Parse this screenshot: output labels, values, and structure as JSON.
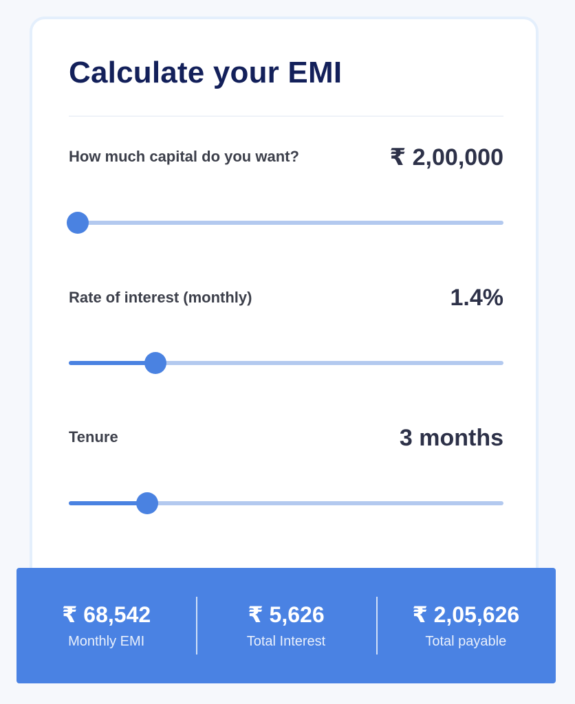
{
  "title": "Calculate your EMI",
  "capital": {
    "label": "How much capital do you want?",
    "value": "₹ 2,00,000",
    "slider_fraction": 0.02
  },
  "interest": {
    "label": "Rate of interest (monthly)",
    "value": "1.4%",
    "slider_fraction": 0.2
  },
  "tenure": {
    "label": "Tenure",
    "value": "3 months",
    "slider_fraction": 0.18
  },
  "summary": {
    "monthly_emi": {
      "value": "₹ 68,542",
      "label": "Monthly EMI"
    },
    "total_interest": {
      "value": "₹ 5,626",
      "label": "Total Interest"
    },
    "total_payable": {
      "value": "₹ 2,05,626",
      "label": "Total payable"
    }
  },
  "colors": {
    "accent": "#4a82e1",
    "track": "#b3c9ef",
    "title": "#13205a"
  }
}
